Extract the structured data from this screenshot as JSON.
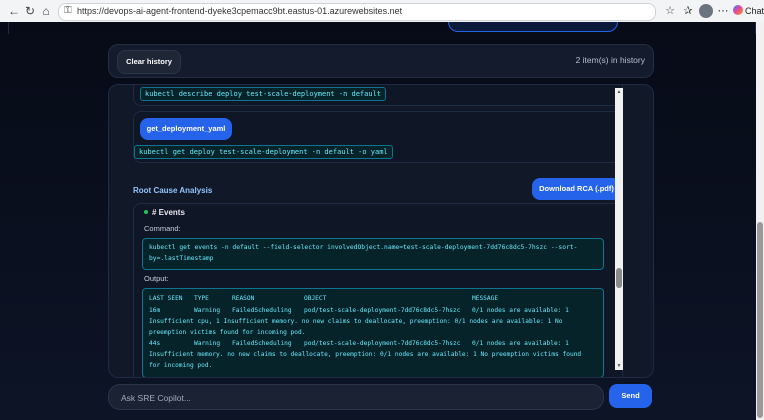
{
  "browser": {
    "url": "https://devops-ai-agent-frontend-dyeke3cpemacc9bt.eastus-01.azurewebsites.net",
    "chat_label": "Chat",
    "icons": [
      "back-icon",
      "refresh-icon",
      "home-icon",
      "lock-icon",
      "star-icon",
      "favorites-icon",
      "more-icon"
    ]
  },
  "history": {
    "clear_label": "Clear history",
    "count": "2 item(s) in history"
  },
  "steps": {
    "cmd1": "kubectl describe deploy test-scale-deployment -n default",
    "tool": "get_deployment_yaml",
    "cmd2": "kubectl get deploy test-scale-deployment -n default -o yaml"
  },
  "rca": {
    "title": "Root Cause Analysis",
    "download_label": "Download RCA (.pdf)",
    "section": "# Events",
    "command_label": "Command:",
    "command_lines": [
      "kubectl get events -n default --field-selector involvedObject.name=test-scale-deployment-7dd76c8dc5-7hszc --sort-",
      "by=.lastTimestamp"
    ],
    "output_label": "Output:",
    "headers": {
      "last_seen": "LAST SEEN",
      "type": "TYPE",
      "reason": "REASON",
      "object": "OBJECT",
      "message": "MESSAGE"
    },
    "rows": [
      {
        "last_seen": "16m",
        "type": "Warning",
        "reason": "FailedScheduling",
        "object": "pod/test-scale-deployment-7dd76c8dc5-7hszc",
        "message": "0/1 nodes are available: 1",
        "wrap": [
          "Insufficient cpu, 1 Insufficient memory. no new claims to deallocate, preemption: 0/1 nodes are available: 1 No",
          "preemption victims found for incoming pod."
        ]
      },
      {
        "last_seen": "44s",
        "type": "Warning",
        "reason": "FailedScheduling",
        "object": "pod/test-scale-deployment-7dd76c8dc5-7hszc",
        "message": "0/1 nodes are available: 1",
        "wrap": [
          "Insufficient memory. no new claims to deallocate, preemption: 0/1 nodes are available: 1 No preemption victims found",
          "for incoming pod."
        ]
      }
    ]
  },
  "composer": {
    "placeholder": "Ask SRE Copilot...",
    "send_label": "Send"
  },
  "colors": {
    "accent": "#2563eb",
    "code_text": "#67e8f9",
    "code_bg": "#06232a",
    "section_title": "#93c5fd",
    "status_dot": "#22c55e"
  }
}
